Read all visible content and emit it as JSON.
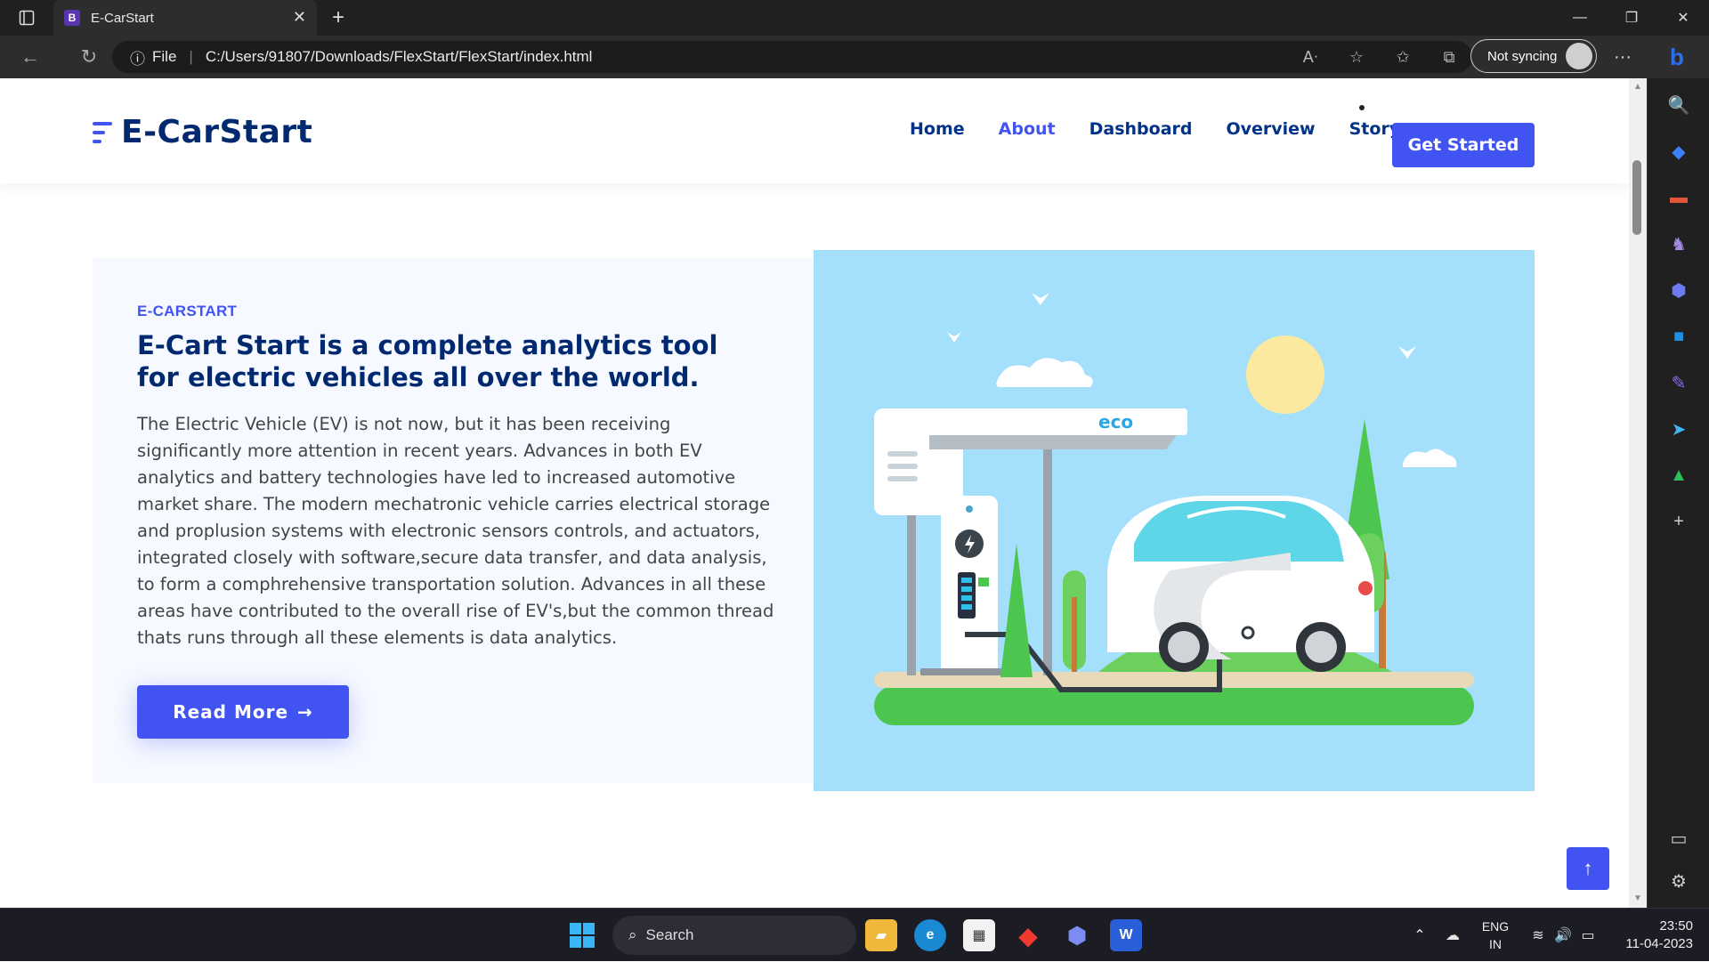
{
  "browser": {
    "tab_title": "E-CarStart",
    "tab_favicon": "B",
    "address_prefix": "File",
    "url": "C:/Users/91807/Downloads/FlexStart/FlexStart/index.html",
    "sync_label": "Not syncing"
  },
  "site": {
    "logo": "E-CarStart",
    "nav": [
      {
        "label": "Home",
        "active": false
      },
      {
        "label": "About",
        "active": true
      },
      {
        "label": "Dashboard",
        "active": false
      },
      {
        "label": "Overview",
        "active": false
      },
      {
        "label": "Story",
        "active": false
      }
    ],
    "cta": "Get Started"
  },
  "about": {
    "eyebrow": "E-CARSTART",
    "title": "E-Cart Start is a complete analytics tool for electric vehicles all over the world.",
    "body": "The Electric Vehicle (EV) is not now, but it has been receiving significantly more attention in recent years. Advances in both EV analytics and battery technologies have led to increased automotive market share. The modern mechatronic vehicle carries electrical storage and proplusion systems with electronic sensors controls, and actuators, integrated closely with software,secure data transfer, and data analysis, to form a comphrehensive transportation solution. Advances in all these areas have contributed to the overall rise of EV's,but the common thread thats runs through all these elements is data analytics.",
    "button": "Read More",
    "illustration_label": "eco"
  },
  "taskbar": {
    "search_label": "Search",
    "lang_top": "ENG",
    "lang_bottom": "IN",
    "time": "23:50",
    "date": "11-04-2023"
  },
  "colors": {
    "accent": "#4154f1",
    "heading": "#012970",
    "illustration_bg": "#a4dffb"
  }
}
